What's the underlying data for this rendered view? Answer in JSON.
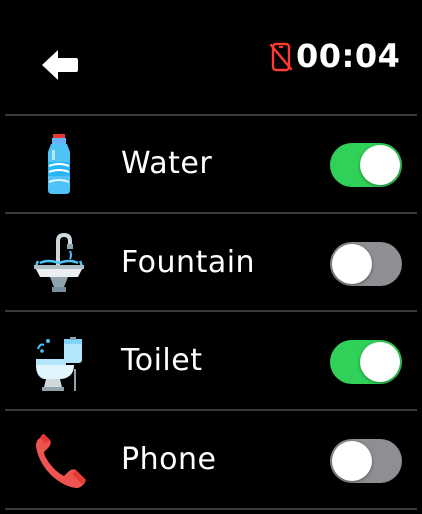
{
  "status_bar": {
    "back_icon": "back-arrow-icon",
    "phone_status_icon": "phone-disconnected-icon",
    "time": "00:04"
  },
  "colors": {
    "toggle_on": "#30d158",
    "toggle_off": "#8e8e93",
    "warning_red": "#ff3b30",
    "background": "#000000"
  },
  "items": [
    {
      "label": "Water",
      "icon": "water-bottle-icon",
      "enabled": true
    },
    {
      "label": "Fountain",
      "icon": "fountain-icon",
      "enabled": false
    },
    {
      "label": "Toilet",
      "icon": "toilet-icon",
      "enabled": true
    },
    {
      "label": "Phone",
      "icon": "phone-icon",
      "enabled": false
    }
  ]
}
